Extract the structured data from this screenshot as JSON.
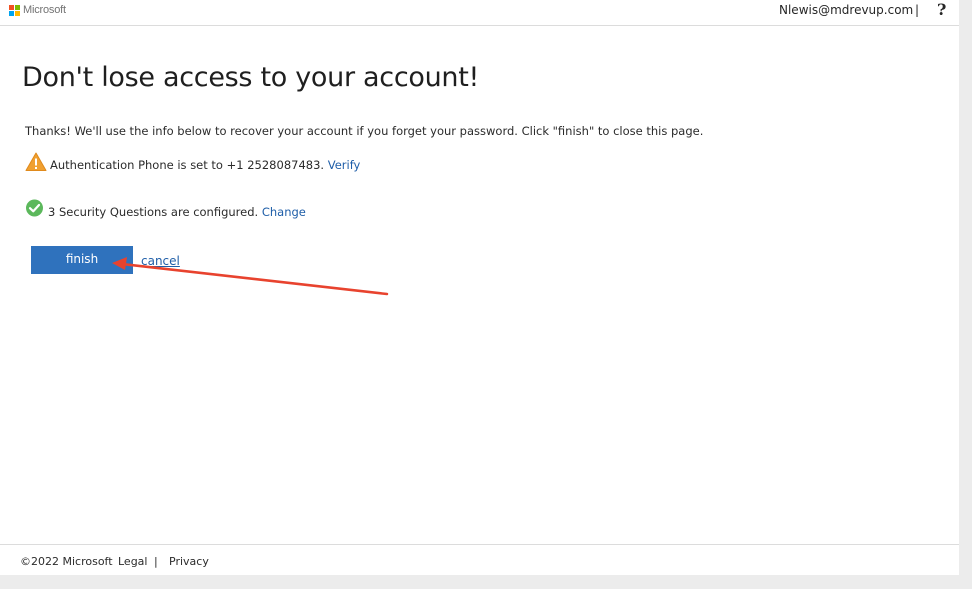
{
  "header": {
    "brand": "Microsoft",
    "user_email": "Nlewis@mdrevup.com",
    "separator": "|",
    "help_label": "?"
  },
  "main": {
    "title": "Don't lose access to your account!",
    "intro": "Thanks! We'll use the info below to recover your account if you forget your password. Click \"finish\" to close this page.",
    "phone": {
      "icon": "warning-icon",
      "text": "Authentication Phone is set to +1 2528087483.",
      "link": "Verify"
    },
    "security_questions": {
      "icon": "checkmark-icon",
      "text": "3 Security Questions are configured.",
      "link": "Change"
    },
    "finish_label": "finish",
    "cancel_label": "cancel"
  },
  "footer": {
    "copyright": "©2022 Microsoft",
    "legal": "Legal",
    "separator": "|",
    "privacy": "Privacy"
  },
  "colors": {
    "accent": "#2f72bd",
    "link": "#1f5ea8",
    "warning": "#f0a030",
    "success": "#5cb85c",
    "annotation_arrow": "#e8432e"
  }
}
